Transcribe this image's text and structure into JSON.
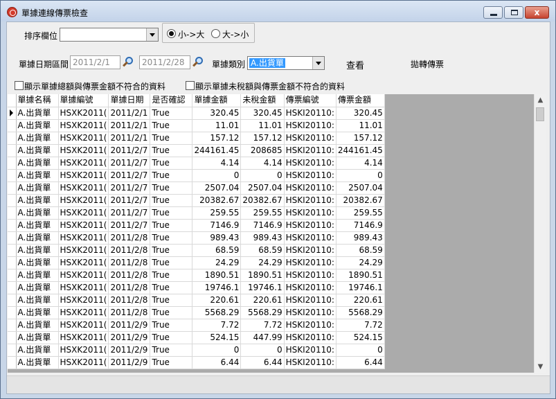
{
  "window": {
    "title": "單據連線傳票檢查",
    "close_label": "x"
  },
  "sort": {
    "label": "排序欄位",
    "value": "",
    "asc_label": "小->大",
    "desc_label": "大->小"
  },
  "filter": {
    "date_label": "單據日期區間",
    "date_from": "2011/2/1",
    "date_to": "2011/2/28",
    "type_label": "單據類別",
    "type_value": "A.出貨單",
    "view_label": "查看",
    "transfer_label": "拋轉傳票"
  },
  "options": {
    "total_mismatch_label": "顯示單據總額與傳票金額不符合的資料",
    "untaxed_mismatch_label": "顯示單據未稅額與傳票金額不符合的資料"
  },
  "grid": {
    "columns": [
      "單據名稱",
      "單據編號",
      "單據日期",
      "是否確認",
      "單據金額",
      "未稅金額",
      "傳票編號",
      "傳票金額"
    ],
    "rows": [
      [
        "A.出貨單",
        "HSXK2011(",
        "2011/2/1",
        "True",
        "320.45",
        "320.45",
        "HSKI20110:",
        "320.45"
      ],
      [
        "A.出貨單",
        "HSXK2011(",
        "2011/2/1",
        "True",
        "11.01",
        "11.01",
        "HSKI20110:",
        "11.01"
      ],
      [
        "A.出貨單",
        "HSXK2011(",
        "2011/2/1",
        "True",
        "157.12",
        "157.12",
        "HSKI20110:",
        "157.12"
      ],
      [
        "A.出貨單",
        "HSXK2011(",
        "2011/2/7",
        "True",
        "244161.45",
        "208685",
        "HSKI20110:",
        "244161.45"
      ],
      [
        "A.出貨單",
        "HSXK2011(",
        "2011/2/7",
        "True",
        "4.14",
        "4.14",
        "HSKI20110:",
        "4.14"
      ],
      [
        "A.出貨單",
        "HSXK2011(",
        "2011/2/7",
        "True",
        "0",
        "0",
        "HSKI20110:",
        "0"
      ],
      [
        "A.出貨單",
        "HSXK2011(",
        "2011/2/7",
        "True",
        "2507.04",
        "2507.04",
        "HSKI20110:",
        "2507.04"
      ],
      [
        "A.出貨單",
        "HSXK2011(",
        "2011/2/7",
        "True",
        "20382.67",
        "20382.67",
        "HSKI20110:",
        "20382.67"
      ],
      [
        "A.出貨單",
        "HSXK2011(",
        "2011/2/7",
        "True",
        "259.55",
        "259.55",
        "HSKI20110:",
        "259.55"
      ],
      [
        "A.出貨單",
        "HSXK2011(",
        "2011/2/7",
        "True",
        "7146.9",
        "7146.9",
        "HSKI20110:",
        "7146.9"
      ],
      [
        "A.出貨單",
        "HSXK2011(",
        "2011/2/8",
        "True",
        "989.43",
        "989.43",
        "HSKI20110:",
        "989.43"
      ],
      [
        "A.出貨單",
        "HSXK2011(",
        "2011/2/8",
        "True",
        "68.59",
        "68.59",
        "HSKI20110:",
        "68.59"
      ],
      [
        "A.出貨單",
        "HSXK2011(",
        "2011/2/8",
        "True",
        "24.29",
        "24.29",
        "HSKI20110:",
        "24.29"
      ],
      [
        "A.出貨單",
        "HSXK2011(",
        "2011/2/8",
        "True",
        "1890.51",
        "1890.51",
        "HSKI20110:",
        "1890.51"
      ],
      [
        "A.出貨單",
        "HSXK2011(",
        "2011/2/8",
        "True",
        "19746.1",
        "19746.1",
        "HSKI20110:",
        "19746.1"
      ],
      [
        "A.出貨單",
        "HSXK2011(",
        "2011/2/8",
        "True",
        "220.61",
        "220.61",
        "HSKI20110:",
        "220.61"
      ],
      [
        "A.出貨單",
        "HSXK2011(",
        "2011/2/8",
        "True",
        "5568.29",
        "5568.29",
        "HSKI20110:",
        "5568.29"
      ],
      [
        "A.出貨單",
        "HSXK2011(",
        "2011/2/9",
        "True",
        "7.72",
        "7.72",
        "HSKI20110:",
        "7.72"
      ],
      [
        "A.出貨單",
        "HSXK2011(",
        "2011/2/9",
        "True",
        "524.15",
        "447.99",
        "HSKI20110:",
        "524.15"
      ],
      [
        "A.出貨單",
        "HSXK2011(",
        "2011/2/9",
        "True",
        "0",
        "0",
        "HSKI20110:",
        "0"
      ],
      [
        "A.出貨單",
        "HSXK2011(",
        "2011/2/9",
        "True",
        "6.44",
        "6.44",
        "HSKI20110:",
        "6.44"
      ]
    ]
  },
  "scroll": {
    "up_glyph": "▲",
    "down_glyph": "▼"
  }
}
